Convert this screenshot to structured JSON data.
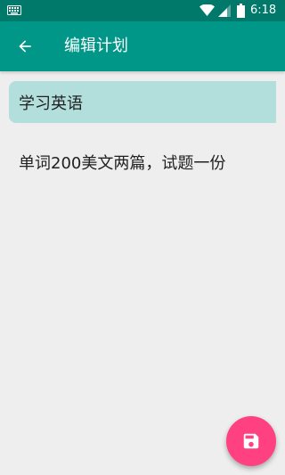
{
  "status_bar": {
    "time": "6:18",
    "icons": [
      "keyboard-icon",
      "wifi-icon",
      "signal-icon",
      "battery-icon"
    ]
  },
  "app_bar": {
    "title": "编辑计划",
    "back_icon": "arrow-back-icon"
  },
  "editor": {
    "title_value": "学习英语",
    "content_value": "单词200美文两篇，试题一份"
  },
  "fab": {
    "icon": "save-icon"
  },
  "colors": {
    "status_bar": "#00796b",
    "app_bar": "#009688",
    "title_field_bg": "#b2dfdb",
    "background": "#eeeeee",
    "fab": "#ff4081"
  }
}
